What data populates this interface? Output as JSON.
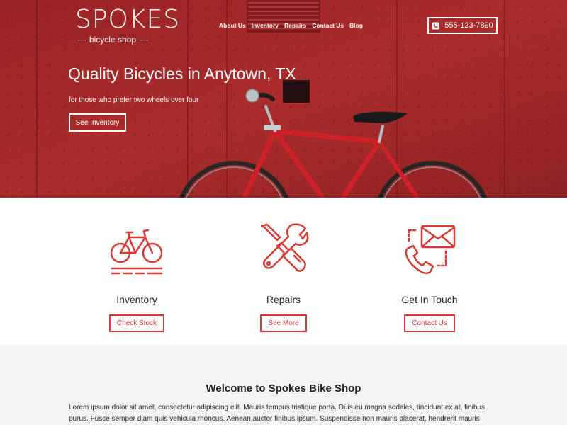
{
  "brand": {
    "name": "SPOKES",
    "subtitle": "bicycle shop"
  },
  "nav": {
    "items": [
      "About Us",
      "Inventory",
      "Repairs",
      "Contact Us",
      "Blog"
    ]
  },
  "header": {
    "phone": "555-123-7890"
  },
  "hero": {
    "title": "Quality Bicycles in Anytown, TX",
    "subtitle": "for those who prefer two wheels over four",
    "button": "See Inventory"
  },
  "features": [
    {
      "title": "Inventory",
      "button": "Check Stock",
      "icon": "bicycle-icon"
    },
    {
      "title": "Repairs",
      "button": "See More",
      "icon": "tools-icon"
    },
    {
      "title": "Get In Touch",
      "button": "Contact Us",
      "icon": "phone-mail-icon"
    }
  ],
  "welcome": {
    "title": "Welcome to Spokes Bike Shop",
    "text": "Lorem ipsum dolor sit amet, consectetur adipiscing elit. Mauris tempus tristique porta. Duis eu magna sodales, tincidunt ex at, finibus purus. Fusce semper diam quis vehicula rhoncus. Aenean auctor finibus ipsum. Suspendisse non mauris placerat, hendrerit mauris"
  },
  "colors": {
    "accent": "#d83a36",
    "hero_wall": "#b42d30",
    "section_bg": "#f3f3f3"
  }
}
